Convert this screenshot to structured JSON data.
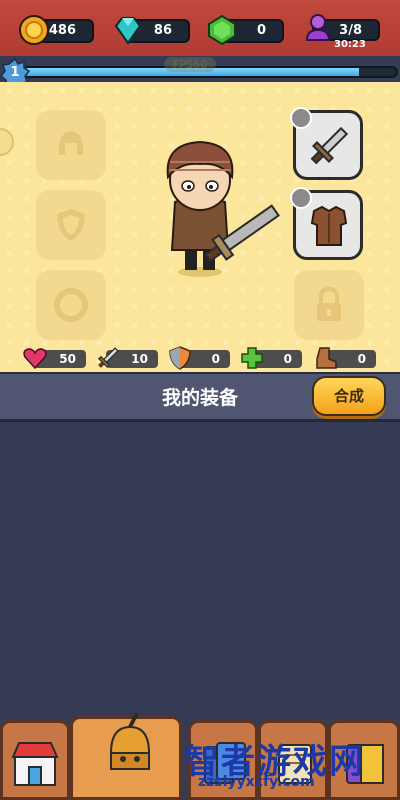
{
  "resources": {
    "gold": "486",
    "gems": "86",
    "green_gems": "0",
    "stamina": "3/8",
    "stamina_timer": "30:23"
  },
  "level": {
    "value": "1",
    "progress": 0.9
  },
  "fps": "FPS60",
  "equipment_slots": {
    "helmet": "empty",
    "shield": "empty",
    "ring": "empty",
    "weapon": "sword",
    "armor": "leather-armor",
    "locked": "lock"
  },
  "stats": {
    "hp": "50",
    "attack": "10",
    "defense": "0",
    "heal": "0",
    "speed": "0"
  },
  "panel": {
    "title": "我的装备",
    "synth_button": "合成"
  },
  "watermark": {
    "brand": "智者游戏网",
    "url": "zzslyyxcfy.com"
  },
  "colors": {
    "top_bar": "#b13b33",
    "stage_bg": "#fbe69c",
    "panel_bg": "#363b55",
    "accent_button": "#f5a11b"
  }
}
